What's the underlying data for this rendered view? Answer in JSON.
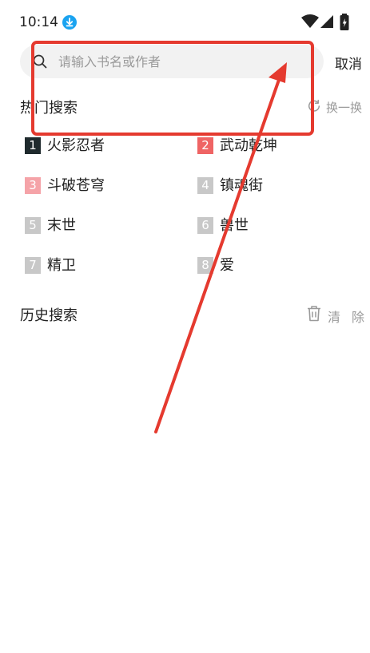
{
  "status_bar": {
    "time": "10:14",
    "icons": [
      "download-badge-icon",
      "wifi-icon",
      "signal-icon",
      "battery-icon"
    ]
  },
  "search": {
    "placeholder": "请输入书名或作者",
    "value": "",
    "cancel_label": "取消"
  },
  "hot_search": {
    "title": "热门搜索",
    "refresh_label": "换一换",
    "items": [
      {
        "rank": "1",
        "label": "火影忍者"
      },
      {
        "rank": "2",
        "label": "武动乾坤"
      },
      {
        "rank": "3",
        "label": "斗破苍穹"
      },
      {
        "rank": "4",
        "label": "镇魂街"
      },
      {
        "rank": "5",
        "label": "末世"
      },
      {
        "rank": "6",
        "label": "兽世"
      },
      {
        "rank": "7",
        "label": "精卫"
      },
      {
        "rank": "8",
        "label": "爱"
      }
    ]
  },
  "history": {
    "title": "历史搜索",
    "clear_label": "清除"
  },
  "colors": {
    "rank_1": "#1f2a2d",
    "rank_2": "#ef6464",
    "rank_3": "#f5a3a8",
    "rank_other": "#c8c8c8",
    "annotation_red": "#e53a2f",
    "download_badge": "#1aa3f0"
  }
}
